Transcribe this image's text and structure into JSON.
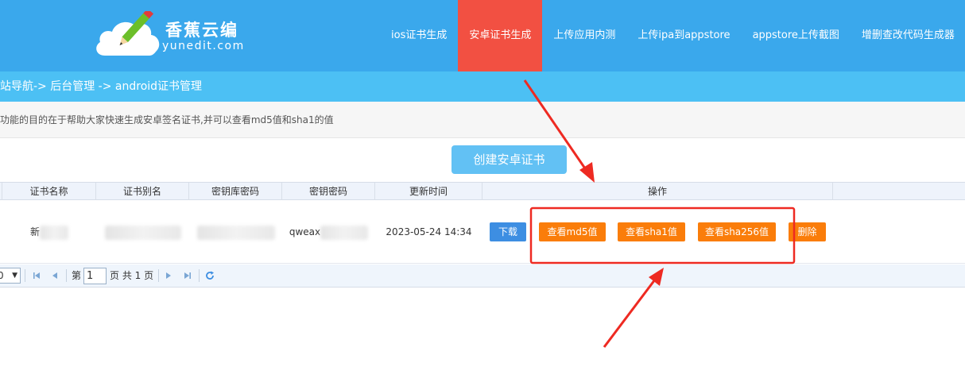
{
  "brand": {
    "title": "香蕉云编",
    "subtitle": "yunedit.com"
  },
  "nav": {
    "items": [
      {
        "label": "ios证书生成",
        "active": false
      },
      {
        "label": "安卓证书生成",
        "active": true
      },
      {
        "label": "上传应用内测",
        "active": false
      },
      {
        "label": "上传ipa到appstore",
        "active": false
      },
      {
        "label": "appstore上传截图",
        "active": false
      },
      {
        "label": "增删查改代码生成器",
        "active": false
      }
    ]
  },
  "breadcrumb": "站导航-> 后台管理 -> android证书管理",
  "description": "功能的目的在于帮助大家快速生成安卓签名证书,并可以查看md5值和sha1的值",
  "create_button": "创建安卓证书",
  "table": {
    "columns": [
      "证书名称",
      "证书别名",
      "密钥库密码",
      "密钥密码",
      "更新时间",
      "操作"
    ],
    "rows": [
      {
        "name": "新",
        "alias": "",
        "store_password": "",
        "key_password": "qweax",
        "updated": "2023-05-24 14:34",
        "actions": {
          "download": "下载",
          "md5": "查看md5值",
          "sha1": "查看sha1值",
          "sha256": "查看sha256值",
          "delete": "删除"
        }
      }
    ]
  },
  "pager": {
    "page_size": "0",
    "page_label_prefix": "第",
    "current_page": "1",
    "page_label_suffix": "页 共 1 页"
  },
  "colors": {
    "header": "#3aa8ec",
    "nav_active": "#f25042",
    "breadcrumb": "#4cc0f4",
    "button_orange": "#fa7d0a",
    "button_blue": "#3d8ee2",
    "annotation_red": "#ee2a22"
  }
}
